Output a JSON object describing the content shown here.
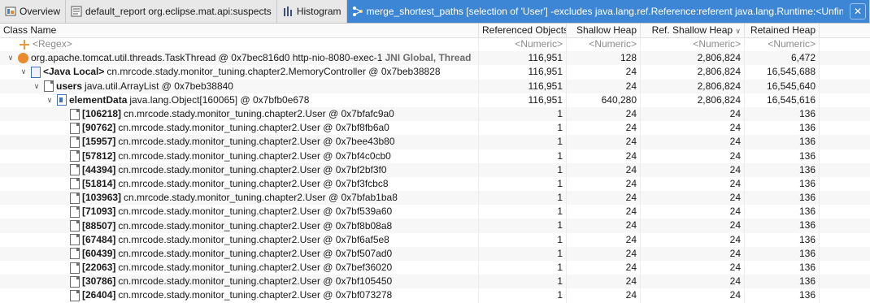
{
  "tabs": [
    {
      "name": "tab-overview",
      "label": "Overview",
      "icon": "overview-icon"
    },
    {
      "name": "tab-suspects",
      "label": "default_report  org.eclipse.mat.api:suspects",
      "icon": "report-icon"
    },
    {
      "name": "tab-histogram",
      "label": "Histogram",
      "icon": "histogram-icon"
    },
    {
      "name": "tab-merge-paths",
      "label": "merge_shortest_paths  [selection of 'User'] -excludes java.lang.ref.Reference:referent java.lang.Runtime:<Unfin...",
      "icon": "paths-icon"
    }
  ],
  "columns": {
    "class_name": "Class Name",
    "referenced": "Referenced Objects",
    "shallow": "Shallow Heap",
    "ref_shallow": "Ref. Shallow Heap",
    "retained": "Retained Heap",
    "sort_indicator": "∨"
  },
  "filter_row": {
    "name": "<Regex>",
    "referenced": "<Numeric>",
    "shallow": "<Numeric>",
    "ref_shallow": "<Numeric>",
    "retained": "<Numeric>"
  },
  "tree_rows": [
    {
      "indent": 0,
      "twisty": "expanded",
      "icon": "thread-icon",
      "bold": "",
      "label": "org.apache.tomcat.util.threads.TaskThread @ 0x7bec816d0  http-nio-8080-exec-1",
      "suffix": "JNI Global, Thread",
      "ref": "116,951",
      "shallow": "128",
      "ref_shallow": "2,806,824",
      "retained": "6,472"
    },
    {
      "indent": 1,
      "twisty": "expanded",
      "icon": "local-icon",
      "bold": "<Java Local>",
      "label": "cn.mrcode.stady.monitor_tuning.chapter2.MemoryController @ 0x7beb38828",
      "suffix": "",
      "ref": "116,951",
      "shallow": "24",
      "ref_shallow": "2,806,824",
      "retained": "16,545,688"
    },
    {
      "indent": 2,
      "twisty": "expanded",
      "icon": "object-icon",
      "bold": "users",
      "label": "java.util.ArrayList @ 0x7beb38840",
      "suffix": "",
      "ref": "116,951",
      "shallow": "24",
      "ref_shallow": "2,806,824",
      "retained": "16,545,640"
    },
    {
      "indent": 3,
      "twisty": "expanded",
      "icon": "array-icon",
      "bold": "elementData",
      "label": "java.lang.Object[160065] @ 0x7bfb0e678",
      "suffix": "",
      "ref": "116,951",
      "shallow": "640,280",
      "ref_shallow": "2,806,824",
      "retained": "16,545,616"
    },
    {
      "indent": 4,
      "twisty": "none",
      "icon": "object-icon",
      "bold": "[106218]",
      "label": "cn.mrcode.stady.monitor_tuning.chapter2.User @ 0x7bfafc9a0",
      "suffix": "",
      "ref": "1",
      "shallow": "24",
      "ref_shallow": "24",
      "retained": "136"
    },
    {
      "indent": 4,
      "twisty": "none",
      "icon": "object-icon",
      "bold": "[90762]",
      "label": "cn.mrcode.stady.monitor_tuning.chapter2.User @ 0x7bf8fb6a0",
      "suffix": "",
      "ref": "1",
      "shallow": "24",
      "ref_shallow": "24",
      "retained": "136"
    },
    {
      "indent": 4,
      "twisty": "none",
      "icon": "object-icon",
      "bold": "[15957]",
      "label": "cn.mrcode.stady.monitor_tuning.chapter2.User @ 0x7bee43b80",
      "suffix": "",
      "ref": "1",
      "shallow": "24",
      "ref_shallow": "24",
      "retained": "136"
    },
    {
      "indent": 4,
      "twisty": "none",
      "icon": "object-icon",
      "bold": "[57812]",
      "label": "cn.mrcode.stady.monitor_tuning.chapter2.User @ 0x7bf4c0cb0",
      "suffix": "",
      "ref": "1",
      "shallow": "24",
      "ref_shallow": "24",
      "retained": "136"
    },
    {
      "indent": 4,
      "twisty": "none",
      "icon": "object-icon",
      "bold": "[44394]",
      "label": "cn.mrcode.stady.monitor_tuning.chapter2.User @ 0x7bf2bf3f0",
      "suffix": "",
      "ref": "1",
      "shallow": "24",
      "ref_shallow": "24",
      "retained": "136"
    },
    {
      "indent": 4,
      "twisty": "none",
      "icon": "object-icon",
      "bold": "[51814]",
      "label": "cn.mrcode.stady.monitor_tuning.chapter2.User @ 0x7bf3fcbc8",
      "suffix": "",
      "ref": "1",
      "shallow": "24",
      "ref_shallow": "24",
      "retained": "136"
    },
    {
      "indent": 4,
      "twisty": "none",
      "icon": "object-icon",
      "bold": "[103963]",
      "label": "cn.mrcode.stady.monitor_tuning.chapter2.User @ 0x7bfab1ba8",
      "suffix": "",
      "ref": "1",
      "shallow": "24",
      "ref_shallow": "24",
      "retained": "136"
    },
    {
      "indent": 4,
      "twisty": "none",
      "icon": "object-icon",
      "bold": "[71093]",
      "label": "cn.mrcode.stady.monitor_tuning.chapter2.User @ 0x7bf539a60",
      "suffix": "",
      "ref": "1",
      "shallow": "24",
      "ref_shallow": "24",
      "retained": "136"
    },
    {
      "indent": 4,
      "twisty": "none",
      "icon": "object-icon",
      "bold": "[88507]",
      "label": "cn.mrcode.stady.monitor_tuning.chapter2.User @ 0x7bf8b08a8",
      "suffix": "",
      "ref": "1",
      "shallow": "24",
      "ref_shallow": "24",
      "retained": "136"
    },
    {
      "indent": 4,
      "twisty": "none",
      "icon": "object-icon",
      "bold": "[67484]",
      "label": "cn.mrcode.stady.monitor_tuning.chapter2.User @ 0x7bf6af5e8",
      "suffix": "",
      "ref": "1",
      "shallow": "24",
      "ref_shallow": "24",
      "retained": "136"
    },
    {
      "indent": 4,
      "twisty": "none",
      "icon": "object-icon",
      "bold": "[60439]",
      "label": "cn.mrcode.stady.monitor_tuning.chapter2.User @ 0x7bf507ad0",
      "suffix": "",
      "ref": "1",
      "shallow": "24",
      "ref_shallow": "24",
      "retained": "136"
    },
    {
      "indent": 4,
      "twisty": "none",
      "icon": "object-icon",
      "bold": "[22063]",
      "label": "cn.mrcode.stady.monitor_tuning.chapter2.User @ 0x7bef36020",
      "suffix": "",
      "ref": "1",
      "shallow": "24",
      "ref_shallow": "24",
      "retained": "136"
    },
    {
      "indent": 4,
      "twisty": "none",
      "icon": "object-icon",
      "bold": "[30786]",
      "label": "cn.mrcode.stady.monitor_tuning.chapter2.User @ 0x7bf105450",
      "suffix": "",
      "ref": "1",
      "shallow": "24",
      "ref_shallow": "24",
      "retained": "136"
    },
    {
      "indent": 4,
      "twisty": "none",
      "icon": "object-icon",
      "bold": "[26404]",
      "label": "cn.mrcode.stady.monitor_tuning.chapter2.User @ 0x7bf073278",
      "suffix": "",
      "ref": "1",
      "shallow": "24",
      "ref_shallow": "24",
      "retained": "136"
    }
  ],
  "colors": {
    "active_tab": "#3d86d6",
    "thread_icon": "#e98a2c",
    "object_icon": "#3d6fc5"
  }
}
